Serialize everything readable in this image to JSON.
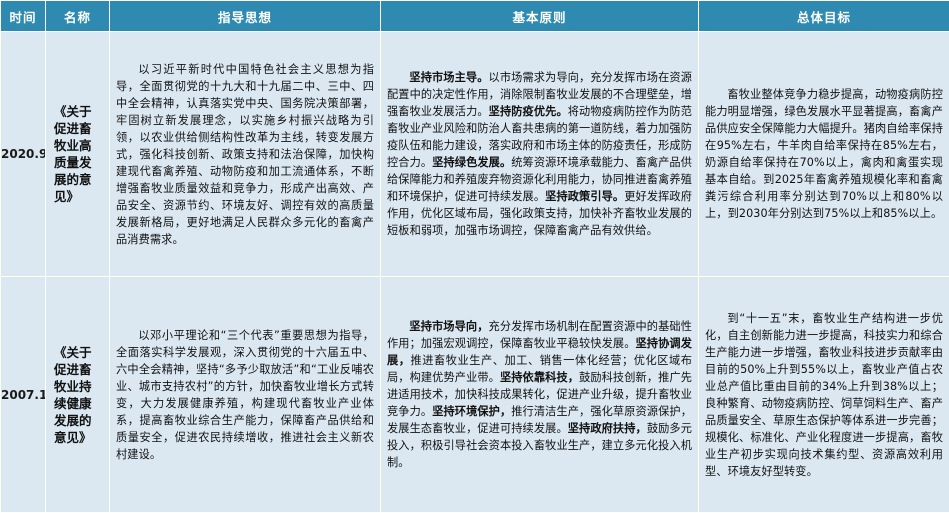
{
  "header": {
    "time": "时间",
    "name": "名称",
    "guiding": "指导思想",
    "principles": "基本原则",
    "goals": "总体目标"
  },
  "rows": [
    {
      "year": "2020.9",
      "name": "《关于促进畜牧业高质量发展的意见》",
      "guiding": "以习近平新时代中国特色社会主义思想为指导，全面贯彻党的十九大和十九届二中、三中、四中全会精神，认真落实党中央、国务院决策部署，牢固树立新发展理念，以实施乡村振兴战略为引领，以农业供给侧结构性改革为主线，转变发展方式，强化科技创新、政策支持和法治保障，加快构建现代畜禽养殖、动物防疫和加工流通体系，不断增强畜牧业质量效益和竞争力，形成产出高效、产品安全、资源节约、环境友好、调控有效的高质量发展新格局，更好地满足人民群众多元化的畜禽产品消费需求。",
      "principles": [
        {
          "bold": "坚持市场主导。",
          "text": "以市场需求为导向，充分发挥市场在资源配置中的决定性作用，消除限制畜牧业发展的不合理壁垒，增强畜牧业发展活力。"
        },
        {
          "bold": "坚持防疫优先。",
          "text": "将动物疫病防控作为防范畜牧业产业风险和防治人畜共患病的第一道防线，着力加强防疫队伍和能力建设，落实政府和市场主体的防疫责任，形成防控合力。"
        },
        {
          "bold": "坚持绿色发展。",
          "text": "统筹资源环境承载能力、畜禽产品供给保障能力和养殖废弃物资源化利用能力，协同推进畜禽养殖和环境保护，促进可持续发展。"
        },
        {
          "bold": "坚持政策引导。",
          "text": "更好发挥政府作用，优化区域布局，强化政策支持，加快补齐畜牧业发展的短板和弱项，加强市场调控，保障畜禽产品有效供给。"
        }
      ],
      "goals": "畜牧业整体竞争力稳步提高，动物疫病防控能力明显增强，绿色发展水平显著提高，畜禽产品供应安全保障能力大幅提升。猪肉自给率保持在95%左右，牛羊肉自给率保持在85%左右，奶源自给率保持在70%以上，禽肉和禽蛋实现基本自给。到2025年畜禽养殖规模化率和畜禽粪污综合利用率分别达到70%以上和80%以上，到2030年分别达到75%以上和85%以上。"
    },
    {
      "year": "2007.1",
      "name": "《关于促进畜牧业持续健康发展的意见》",
      "guiding": "以邓小平理论和“三个代表”重要思想为指导，全面落实科学发展观，深入贯彻党的十六届五中、六中全会精神，坚持“多予少取放活”和“工业反哺农业、城市支持农村”的方针，加快畜牧业增长方式转变，大力发展健康养殖，构建现代畜牧业产业体系，提高畜牧业综合生产能力，保障畜产品供给和质量安全，促进农民持续增收，推进社会主义新农村建设。",
      "principles": [
        {
          "bold": "坚持市场导向，",
          "text": "充分发挥市场机制在配置资源中的基础性作用；加强宏观调控，保障畜牧业平稳较快发展。"
        },
        {
          "bold": "坚持协调发展，",
          "text": "推进畜牧业生产、加工、销售一体化经营；优化区域布局，构建优势产业带。"
        },
        {
          "bold": "坚持依靠科技，",
          "text": "鼓励科技创新，推广先进适用技术，加快科技成果转化，促进产业升级，提升畜牧业竞争力。"
        },
        {
          "bold": "坚持环境保护，",
          "text": "推行清洁生产，强化草原资源保护，发展生态畜牧业，促进可持续发展。"
        },
        {
          "bold": "坚持政府扶持，",
          "text": "鼓励多元投入，积极引导社会资本投入畜牧业生产，建立多元化投入机制。"
        }
      ],
      "goals": "到“十一五”末，畜牧业生产结构进一步优化，自主创新能力进一步提高，科技实力和综合生产能力进一步增强，畜牧业科技进步贡献率由目前的50%上升到55%以上，畜牧业产值占农业总产值比重由目前的34%上升到38%以上；良种繁育、动物疫病防控、饲草饲料生产、畜产品质量安全、草原生态保护等体系进一步完善；规模化、标准化、产业化程度进一步提高，畜牧业生产初步实现向技术集约型、资源高效利用型、环境友好型转变。"
    }
  ],
  "colors": {
    "header_bg": "#2e8ab0",
    "row_bg": "#dbe8f2",
    "header_text": "#ffffff"
  }
}
